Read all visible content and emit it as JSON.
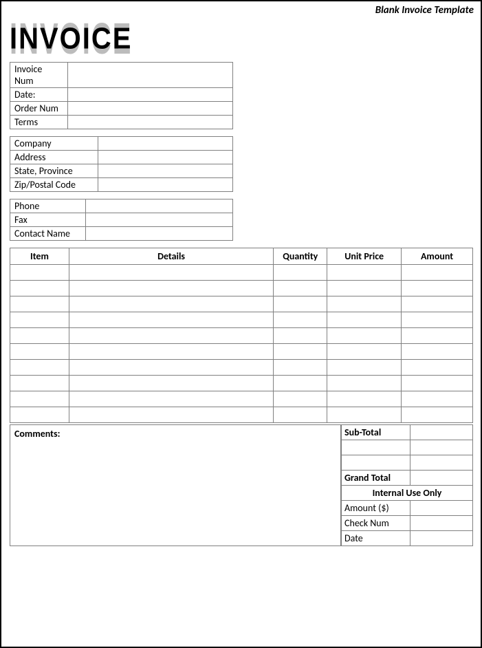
{
  "template_label": "Blank Invoice Template",
  "logo_text": "INVOICE",
  "block1": {
    "rows": [
      {
        "label": "Invoice Num",
        "value": ""
      },
      {
        "label": "Date:",
        "value": ""
      },
      {
        "label": "Order Num",
        "value": ""
      },
      {
        "label": "Terms",
        "value": ""
      }
    ]
  },
  "block2": {
    "rows": [
      {
        "label": "Company",
        "value": ""
      },
      {
        "label": "Address",
        "value": ""
      },
      {
        "label": "State, Province",
        "value": ""
      },
      {
        "label": "Zip/Postal Code",
        "value": ""
      }
    ]
  },
  "block3": {
    "rows": [
      {
        "label": "Phone",
        "value": ""
      },
      {
        "label": "Fax",
        "value": ""
      },
      {
        "label": "Contact Name",
        "value": ""
      }
    ]
  },
  "columns": {
    "item": "Item",
    "details": "Details",
    "quantity": "Quantity",
    "unit_price": "Unit Price",
    "amount": "Amount"
  },
  "line_items": [
    {
      "item": "",
      "details": "",
      "quantity": "",
      "unit_price": "",
      "amount": ""
    },
    {
      "item": "",
      "details": "",
      "quantity": "",
      "unit_price": "",
      "amount": ""
    },
    {
      "item": "",
      "details": "",
      "quantity": "",
      "unit_price": "",
      "amount": ""
    },
    {
      "item": "",
      "details": "",
      "quantity": "",
      "unit_price": "",
      "amount": ""
    },
    {
      "item": "",
      "details": "",
      "quantity": "",
      "unit_price": "",
      "amount": ""
    },
    {
      "item": "",
      "details": "",
      "quantity": "",
      "unit_price": "",
      "amount": ""
    },
    {
      "item": "",
      "details": "",
      "quantity": "",
      "unit_price": "",
      "amount": ""
    },
    {
      "item": "",
      "details": "",
      "quantity": "",
      "unit_price": "",
      "amount": ""
    },
    {
      "item": "",
      "details": "",
      "quantity": "",
      "unit_price": "",
      "amount": ""
    },
    {
      "item": "",
      "details": "",
      "quantity": "",
      "unit_price": "",
      "amount": ""
    }
  ],
  "comments_label": "Comments:",
  "totals": {
    "subtotal_label": "Sub-Total",
    "subtotal_value": "",
    "extra1_label": "",
    "extra1_value": "",
    "extra2_label": "",
    "extra2_value": "",
    "grand_label": "Grand Total",
    "grand_value": "",
    "internal_header": "Internal Use Only",
    "amount_label": "Amount ($)",
    "amount_value": "",
    "check_label": "Check Num",
    "check_value": "",
    "date_label": "Date",
    "date_value": ""
  }
}
